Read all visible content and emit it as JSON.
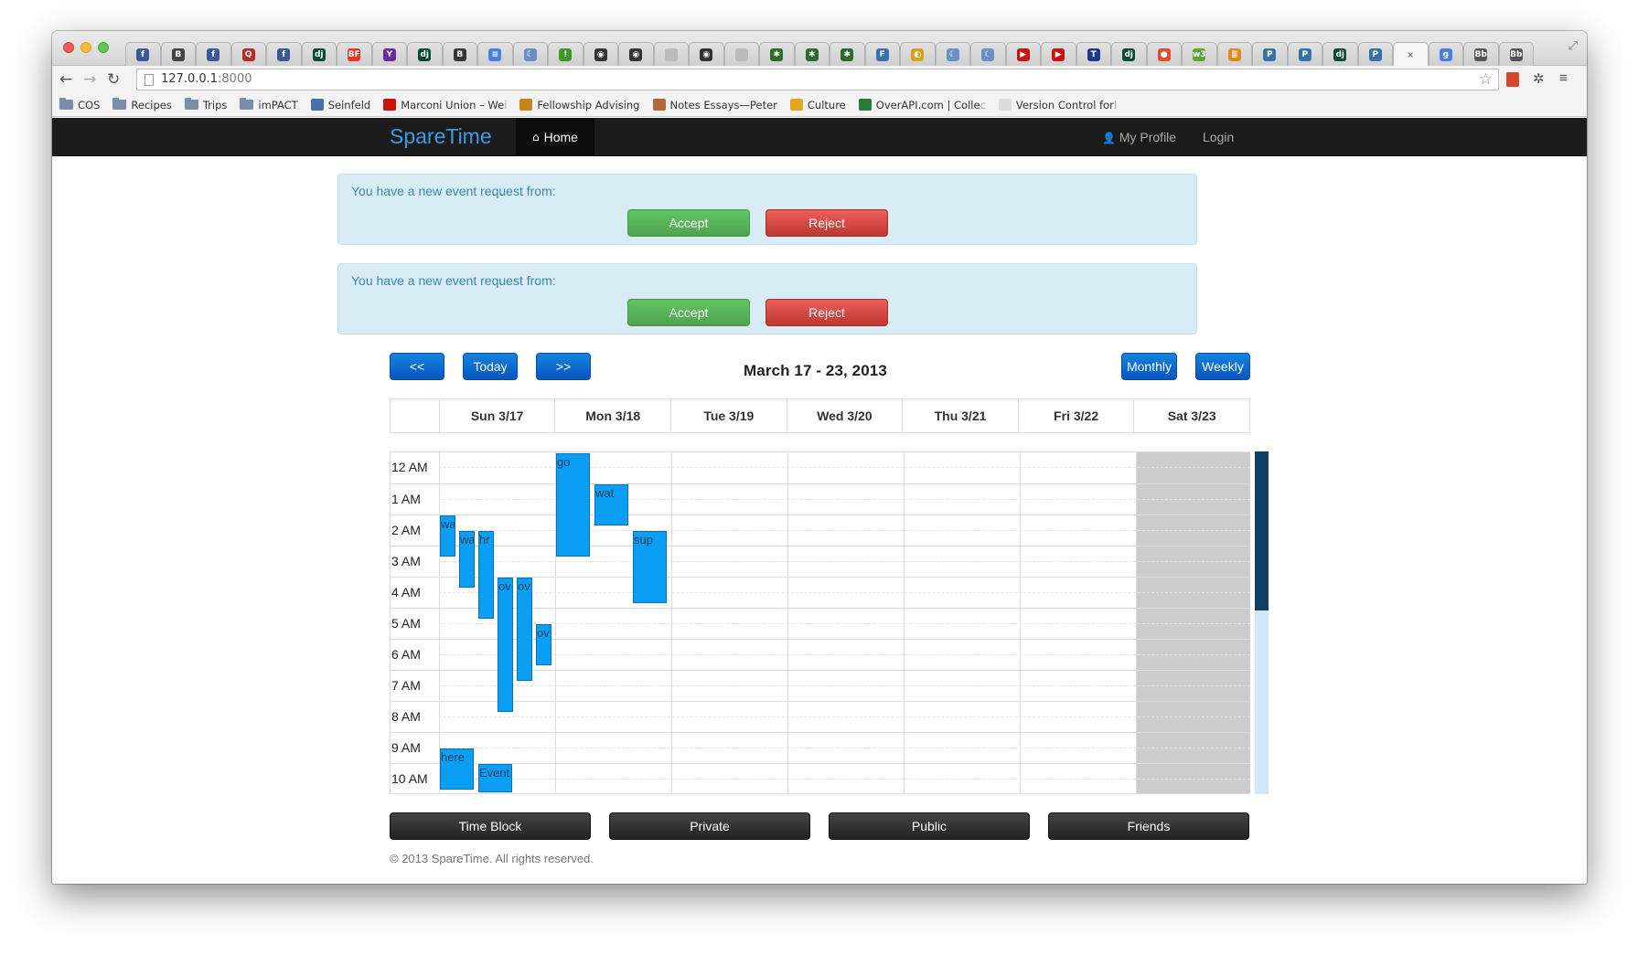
{
  "browser": {
    "url_host": "127.0.0.1",
    "url_port": ":8000",
    "tabs": [
      {
        "icon": "facebook-icon",
        "color": "#3b5998",
        "glyph": "f"
      },
      {
        "icon": "gothic-b-icon",
        "color": "#444444",
        "glyph": "B"
      },
      {
        "icon": "facebook-icon",
        "color": "#3b5998",
        "glyph": "f"
      },
      {
        "icon": "quora-icon",
        "color": "#b92b27",
        "glyph": "Q"
      },
      {
        "icon": "facebook-icon",
        "color": "#3b5998",
        "glyph": "f"
      },
      {
        "icon": "django-icon",
        "color": "#0c4b33",
        "glyph": "dj"
      },
      {
        "icon": "buzzfeed-icon",
        "color": "#ee3322",
        "glyph": "BF"
      },
      {
        "icon": "yahoo-icon",
        "color": "#6a2aa0",
        "glyph": "Y"
      },
      {
        "icon": "django-icon",
        "color": "#0c4b33",
        "glyph": "dj"
      },
      {
        "icon": "bootstrap-icon",
        "color": "#353535",
        "glyph": "B"
      },
      {
        "icon": "docs-icon",
        "color": "#4a7fe0",
        "glyph": "≡"
      },
      {
        "icon": "moon-icon",
        "color": "#6a8fc7",
        "glyph": "☾"
      },
      {
        "icon": "exclamation-icon",
        "color": "#3a9a2a",
        "glyph": "!"
      },
      {
        "icon": "github-icon",
        "color": "#333333",
        "glyph": "◉"
      },
      {
        "icon": "github-icon",
        "color": "#333333",
        "glyph": "◉"
      },
      {
        "icon": "page-icon",
        "color": "#bbbbbb",
        "glyph": ""
      },
      {
        "icon": "github-icon",
        "color": "#333333",
        "glyph": "◉"
      },
      {
        "icon": "page-icon",
        "color": "#bbbbbb",
        "glyph": ""
      },
      {
        "icon": "leaf-icon",
        "color": "#2d6b2d",
        "glyph": "✱"
      },
      {
        "icon": "leaf-icon",
        "color": "#2d6b2d",
        "glyph": "✱"
      },
      {
        "icon": "leaf-icon",
        "color": "#2d6b2d",
        "glyph": "✱"
      },
      {
        "icon": "faq-icon",
        "color": "#3a6fb0",
        "glyph": "F"
      },
      {
        "icon": "chrome-icon",
        "color": "#d9a21c",
        "glyph": "◐"
      },
      {
        "icon": "moon-icon",
        "color": "#6a8fc7",
        "glyph": "☾"
      },
      {
        "icon": "moon-icon",
        "color": "#6a8fc7",
        "glyph": "☾"
      },
      {
        "icon": "youtube-icon",
        "color": "#cc1111",
        "glyph": "▶"
      },
      {
        "icon": "youtube-icon",
        "color": "#cc1111",
        "glyph": "▶"
      },
      {
        "icon": "twc-icon",
        "color": "#1a3a8a",
        "glyph": "T"
      },
      {
        "icon": "django-icon",
        "color": "#0c4b33",
        "glyph": "dj"
      },
      {
        "icon": "color-wheel-icon",
        "color": "#e54a2a",
        "glyph": "●"
      },
      {
        "icon": "w3-icon",
        "color": "#5da233",
        "glyph": "w3"
      },
      {
        "icon": "stack-icon",
        "color": "#e08a1b",
        "glyph": "≣"
      },
      {
        "icon": "python-icon",
        "color": "#3572a5",
        "glyph": "P"
      },
      {
        "icon": "python-icon",
        "color": "#3572a5",
        "glyph": "P"
      },
      {
        "icon": "django-icon",
        "color": "#0c4b33",
        "glyph": "dj"
      },
      {
        "icon": "python-icon",
        "color": "#3572a5",
        "glyph": "P"
      },
      {
        "icon": "close-icon",
        "color": "#f6f6f6",
        "glyph": "×",
        "active": true
      },
      {
        "icon": "google-plus-icon",
        "color": "#4a7fe0",
        "glyph": "g"
      },
      {
        "icon": "bb-icon",
        "color": "#555555",
        "glyph": "Bb"
      },
      {
        "icon": "bb-icon",
        "color": "#555555",
        "glyph": "Bb"
      }
    ],
    "bookmarks": [
      {
        "label": "COS",
        "type": "folder"
      },
      {
        "label": "Recipes",
        "type": "folder"
      },
      {
        "label": "Trips",
        "type": "folder"
      },
      {
        "label": "imPACT",
        "type": "folder"
      },
      {
        "label": "Seinfeld",
        "type": "link",
        "icon": "seinfeld-icon",
        "color": "#4a6fa5"
      },
      {
        "label": "Marconi Union – We",
        "type": "link",
        "icon": "youtube-icon",
        "color": "#cc1111",
        "fade": "i"
      },
      {
        "label": "Fellowship Advising",
        "type": "link",
        "icon": "shield-icon",
        "color": "#c8841c"
      },
      {
        "label": "Notes Essays—Peter",
        "type": "link",
        "icon": "notes-icon",
        "color": "#b06a3a"
      },
      {
        "label": "Culture",
        "type": "link",
        "icon": "culture-icon",
        "color": "#e6a520"
      },
      {
        "label": "OverAPI.com | Colle",
        "type": "link",
        "icon": "overapi-icon",
        "color": "#2c7a3a",
        "fade": "c"
      },
      {
        "label": "Version Control for ",
        "type": "link",
        "icon": "page-icon",
        "color": "#dddddd",
        "fade": "I"
      }
    ]
  },
  "app": {
    "brand": "SpareTime",
    "nav_home": "Home",
    "nav_profile": "My Profile",
    "nav_login": "Login"
  },
  "requests": [
    {
      "message": "You have a new event request from:",
      "accept": "Accept",
      "reject": "Reject"
    },
    {
      "message": "You have a new event request from:",
      "accept": "Accept",
      "reject": "Reject"
    }
  ],
  "calendar": {
    "prev_label": "<<",
    "today_label": "Today",
    "next_label": ">>",
    "week_title": "March 17 - 23, 2013",
    "monthly_label": "Monthly",
    "weekly_label": "Weekly",
    "days": [
      "Sun 3/17",
      "Mon 3/18",
      "Tue 3/19",
      "Wed 3/20",
      "Thu 3/21",
      "Fri 3/22",
      "Sat 3/23"
    ],
    "hours": [
      "12 AM",
      "1 AM",
      "2 AM",
      "3 AM",
      "4 AM",
      "5 AM",
      "6 AM",
      "7 AM",
      "8 AM",
      "9 AM",
      "10 AM"
    ],
    "events": [
      {
        "title": "wa",
        "day": 0,
        "start": 2.0,
        "end": 3.33,
        "lane": 0
      },
      {
        "title": "wa",
        "day": 0,
        "start": 2.5,
        "end": 4.33,
        "lane": 1
      },
      {
        "title": "hr",
        "day": 0,
        "start": 2.5,
        "end": 5.33,
        "lane": 2
      },
      {
        "title": "ov",
        "day": 0,
        "start": 4.0,
        "end": 8.33,
        "lane": 3
      },
      {
        "title": "ov",
        "day": 0,
        "start": 4.0,
        "end": 7.33,
        "lane": 4
      },
      {
        "title": "ov",
        "day": 0,
        "start": 5.5,
        "end": 6.83,
        "lane": 5
      },
      {
        "title": "here",
        "day": 0,
        "start": 9.5,
        "end": 10.83,
        "lane": 0
      },
      {
        "title": "Event",
        "day": 0,
        "start": 10.0,
        "end": 10.9,
        "lane": 2
      },
      {
        "title": "go",
        "day": 1,
        "start": 0.0,
        "end": 3.33,
        "lane": 0
      },
      {
        "title": "wat",
        "day": 1,
        "start": 1.0,
        "end": 2.33,
        "lane": 1
      },
      {
        "title": "sup",
        "day": 1,
        "start": 2.5,
        "end": 4.83,
        "lane": 2
      }
    ],
    "highlight_day": 6
  },
  "filters": [
    "Time Block",
    "Private",
    "Public",
    "Friends"
  ],
  "footer": "© 2013 SpareTime. All rights reserved."
}
